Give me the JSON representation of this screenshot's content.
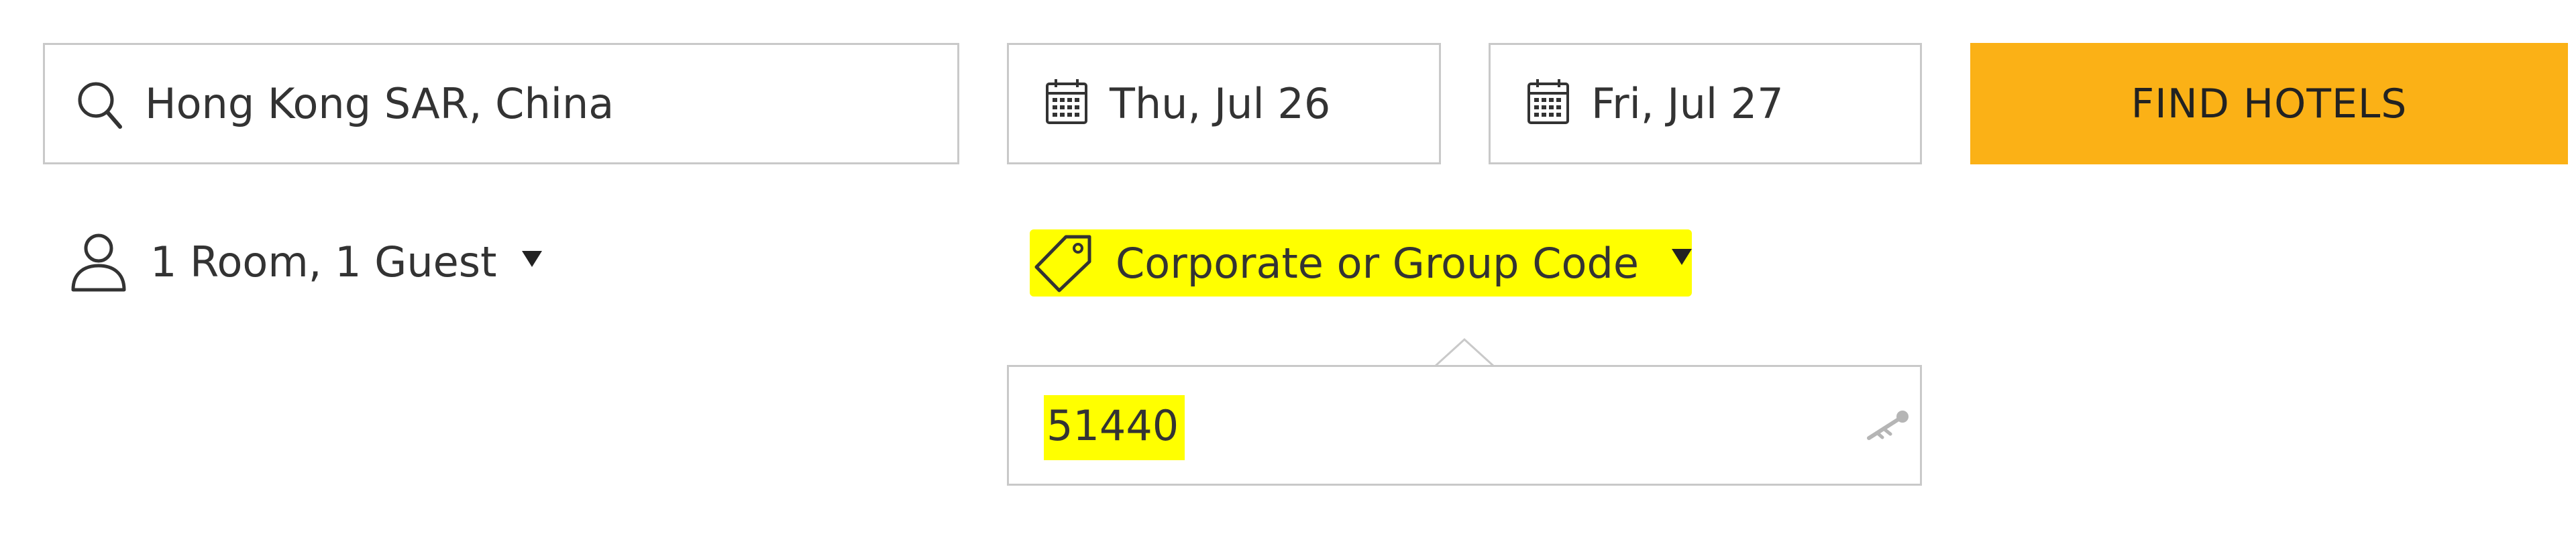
{
  "search": {
    "destination": "Hong Kong SAR, China",
    "checkin": "Thu, Jul 26",
    "checkout": "Fri, Jul 27",
    "find_label": "FIND HOTELS"
  },
  "options": {
    "rooms_guests": "1 Room, 1 Guest",
    "promo_label": "Corporate or Group Code",
    "promo_code": "51440"
  },
  "icons": {
    "destination": "search-icon",
    "checkin": "calendar-icon",
    "checkout": "calendar-icon",
    "rooms_guests": "person-icon",
    "rooms_dropdown": "caret-down-icon",
    "promo": "tag-icon",
    "promo_dropdown": "caret-down-icon",
    "promo_input": "key-icon"
  },
  "colors": {
    "accent": "#fbb116",
    "highlight": "#ffff00",
    "border": "#c9c9c9",
    "text": "#333333"
  }
}
